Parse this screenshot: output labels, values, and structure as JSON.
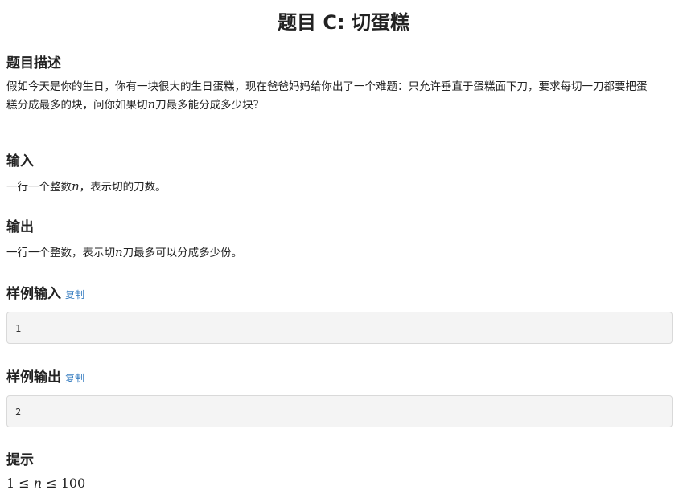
{
  "title": "题目 C: 切蛋糕",
  "description": {
    "heading": "题目描述",
    "text_line1": "假如今天是你的生日，你有一块很大的生日蛋糕，现在爸爸妈妈给你出了一个难题：只允许垂直于蛋糕面下刀，要求每切一刀都要把蛋",
    "text_line2_before": "糕分成最多的块，问你如果切",
    "text_line2_var": "n",
    "text_line2_after": "刀最多能分成多少块？"
  },
  "input": {
    "heading": "输入",
    "text_before": "一行一个整数",
    "text_var": "n",
    "text_after": "，表示切的刀数。"
  },
  "output": {
    "heading": "输出",
    "text_before": "一行一个整数，表示切",
    "text_var": "n",
    "text_after": "刀最多可以分成多少份。"
  },
  "sample_input": {
    "heading": "样例输入",
    "copy_label": "复制",
    "value": "1"
  },
  "sample_output": {
    "heading": "样例输出",
    "copy_label": "复制",
    "value": "2"
  },
  "hint": {
    "heading": "提示",
    "formula_left": "1",
    "formula_op1": "≤",
    "formula_var": "n",
    "formula_op2": "≤",
    "formula_right": "100"
  }
}
